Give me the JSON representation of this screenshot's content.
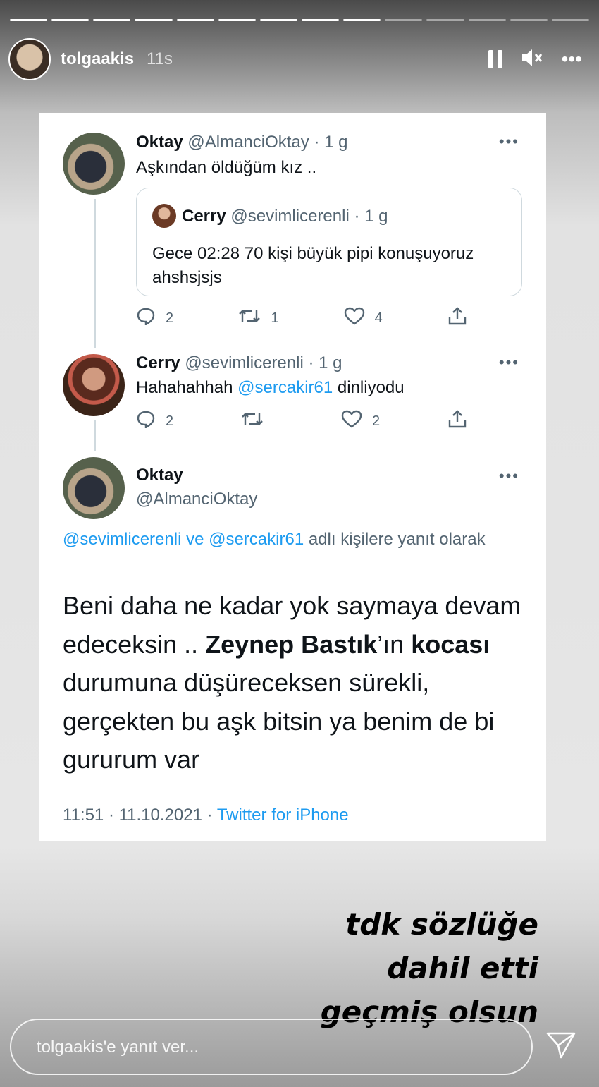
{
  "story": {
    "username": "tolgaakis",
    "time": "11s",
    "progress": {
      "segments": 14,
      "completed": 9
    },
    "controls": {
      "pause_icon": "pause-icon",
      "mute_icon": "mute-icon",
      "more_label": "•••"
    }
  },
  "tweets": [
    {
      "name": "Oktay",
      "handle": "@AlmanciOktay · 1 g",
      "text": "Aşkından öldüğüm kız ..",
      "quote": {
        "name": "Cerry",
        "handle": "@sevimlicerenli · 1 g",
        "text": "Gece 02:28 70 kişi büyük pipi konuşuyoruz ahshsjsjs"
      },
      "actions": {
        "replies": "2",
        "retweets": "1",
        "likes": "4"
      }
    },
    {
      "name": "Cerry",
      "handle": "@sevimlicerenli · 1 g",
      "text_prefix": "Hahahahhah ",
      "mention": "@sercakir61",
      "text_suffix": " dinliyodu",
      "actions": {
        "replies": "2",
        "retweets": "",
        "likes": "2"
      }
    }
  ],
  "main_tweet": {
    "name": "Oktay",
    "handle": "@AlmanciOktay",
    "reply_mention1": "@sevimlicerenli",
    "reply_ve": " ve ",
    "reply_mention2": "@sercakir61",
    "reply_suffix": " adlı kişilere yanıt olarak",
    "text_part1": "Beni daha ne kadar yok saymaya devam edeceksin .. ",
    "text_bold1": "Zeynep Bastık",
    "text_part2": "’ın ",
    "text_bold2": "kocası",
    "text_part3": " durumuna düşüreceksen sürekli, gerçekten bu aşk bitsin ya benim de bi gururum var",
    "timestamp": "11:51 · 11.10.2021 · ",
    "source": "Twitter for iPhone"
  },
  "caption": {
    "line1": "tdk sözlüğe",
    "line2": "dahil etti",
    "line3": "geçmiş olsun"
  },
  "reply": {
    "placeholder": "tolgaakis'e yanıt ver..."
  }
}
